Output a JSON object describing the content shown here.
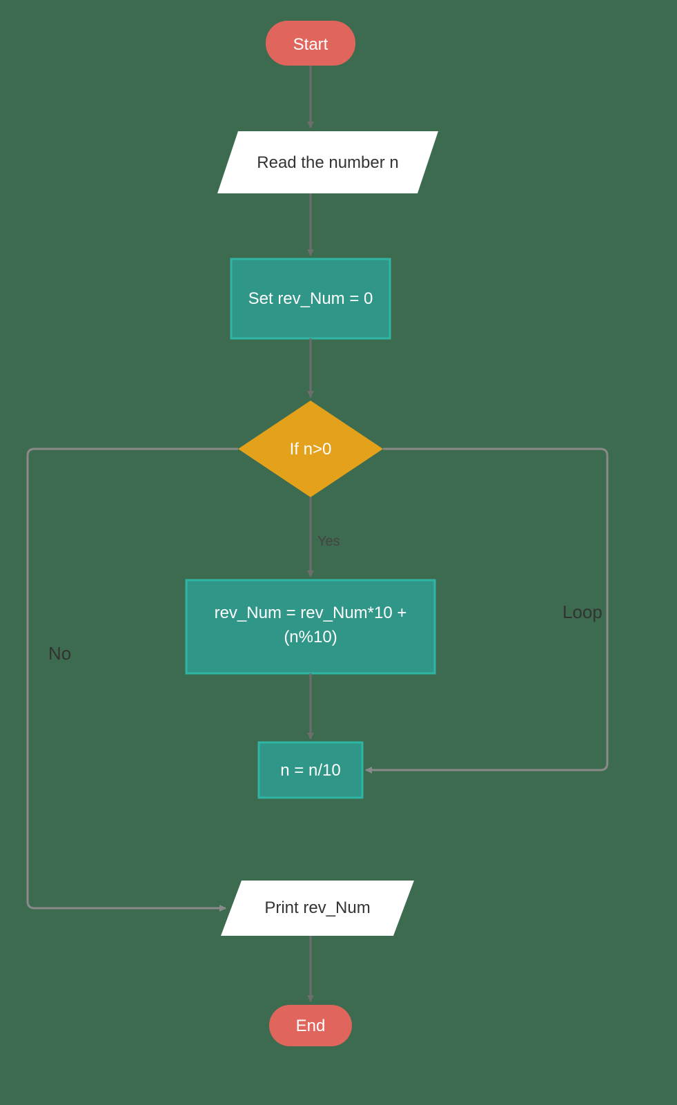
{
  "flowchart": {
    "nodes": {
      "start": {
        "label": "Start"
      },
      "read": {
        "label": "Read the number n"
      },
      "init": {
        "label": "Set rev_Num = 0"
      },
      "decision": {
        "label": "If n>0"
      },
      "calc": {
        "label_line1": "rev_Num = rev_Num*10 +",
        "label_line2": "(n%10)"
      },
      "divide": {
        "label": "n = n/10"
      },
      "print": {
        "label": "Print rev_Num"
      },
      "end": {
        "label": "End"
      }
    },
    "edges": {
      "yes": {
        "label": "Yes"
      },
      "no": {
        "label": "No"
      },
      "loop": {
        "label": "Loop"
      }
    }
  },
  "colors": {
    "terminal": "#e0655d",
    "process": "#2f9688",
    "process_border": "#2fb5a3",
    "decision": "#e4a11b",
    "io": "#ffffff",
    "arrow": "#6d6d6d",
    "arrow_light": "#8a8a8a"
  }
}
